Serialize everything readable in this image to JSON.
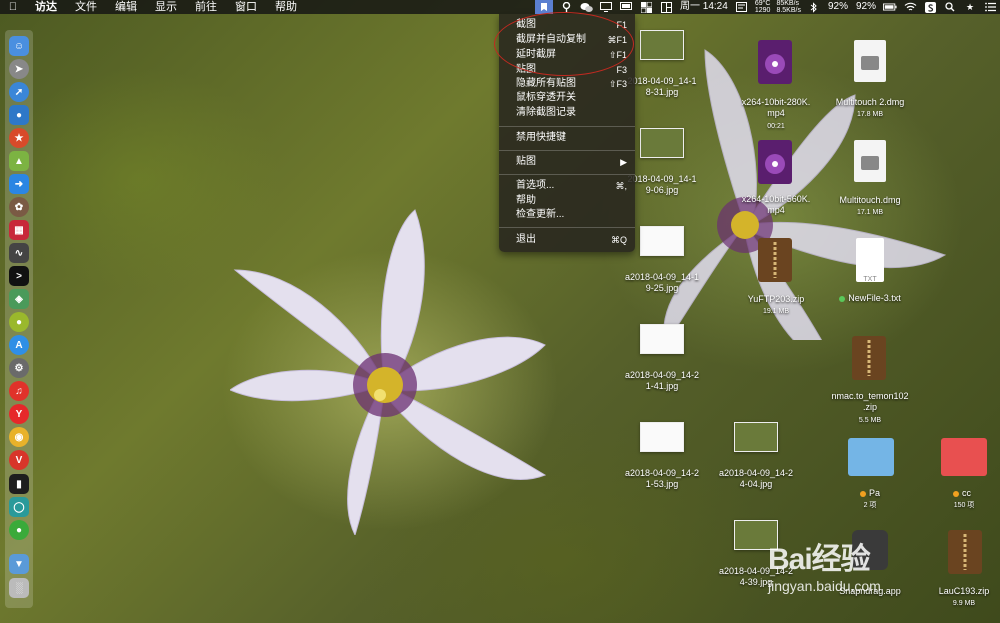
{
  "menubar": {
    "app_name": "访达",
    "menus": [
      "文件",
      "编辑",
      "显示",
      "前往",
      "窗口",
      "帮助"
    ],
    "net_up": "85KB/s",
    "net_down": "8.5KB/s",
    "temp": "69°C",
    "fan": "1290",
    "clock": "周一 14:24",
    "battery_a": "92%",
    "battery_b": "92%"
  },
  "dropdown": {
    "items": [
      {
        "label": "截图",
        "shortcut": "F1"
      },
      {
        "label": "截屏并自动复制",
        "shortcut": "⌘F1"
      },
      {
        "label": "延时截屏",
        "shortcut": "⇧F1"
      },
      {
        "label": "贴图",
        "shortcut": "F3"
      },
      {
        "label": "隐藏所有贴图",
        "shortcut": "⇧F3"
      },
      {
        "label": "鼠标穿透开关",
        "shortcut": ""
      },
      {
        "label": "清除截图记录",
        "shortcut": ""
      },
      {
        "label": "禁用快捷键",
        "shortcut": ""
      },
      {
        "label": "贴图",
        "shortcut": "▶"
      },
      {
        "label": "首选项...",
        "shortcut": "⌘,"
      },
      {
        "label": "帮助",
        "shortcut": ""
      },
      {
        "label": "检查更新...",
        "shortcut": ""
      },
      {
        "label": "退出",
        "shortcut": "⌘Q"
      }
    ]
  },
  "files": [
    {
      "name": "2018-04-09_14-1\n8-31.jpg",
      "size": ""
    },
    {
      "name": "2018-04-09_14-1\n9-06.jpg",
      "size": ""
    },
    {
      "name": "a2018-04-09_14-1\n9-25.jpg",
      "size": ""
    },
    {
      "name": "a2018-04-09_14-2\n1-41.jpg",
      "size": ""
    },
    {
      "name": "a2018-04-09_14-2\n1-53.jpg",
      "size": ""
    },
    {
      "name": "a2018-04-09_14-2\n4-04.jpg",
      "size": ""
    },
    {
      "name": "a2018-04-09_14-2\n4-39.jpg",
      "size": ""
    },
    {
      "name": "x264-10bit-280K.\nmp4",
      "size": "00:21"
    },
    {
      "name": "x264-10bit-560K.\nmp4",
      "size": "00:21"
    },
    {
      "name": "YuFTP203.zip",
      "size": "19.1 MB"
    },
    {
      "name": "Multitouch 2.dmg",
      "size": "17.8 MB"
    },
    {
      "name": "Multitouch.dmg",
      "size": "17.1 MB"
    },
    {
      "name": "NewFile-3.txt",
      "size": ""
    },
    {
      "name": "nmac.to_temon102\n.zip",
      "size": "5.5 MB"
    },
    {
      "name": "Pa",
      "size": "2 项"
    },
    {
      "name": "cc",
      "size": "150 项"
    },
    {
      "name": "Snapndrag.app",
      "size": ""
    },
    {
      "name": "LauC193.zip",
      "size": "9.9 MB"
    }
  ],
  "txt_label": "TXT",
  "watermark": {
    "brand": "Bai经验",
    "url": "jingyan.baidu.com"
  },
  "colors": {
    "menubar": "#141414",
    "accent": "#5b7fd0",
    "circle": "#c02a20",
    "folder": "#74b5e6",
    "folder_red": "#e85050"
  }
}
